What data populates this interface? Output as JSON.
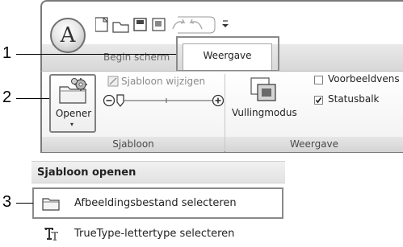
{
  "callouts": [
    "1",
    "2",
    "3"
  ],
  "app_button": {
    "letter": "A"
  },
  "tabs": {
    "inactive_label": "Begin scherm",
    "active_label": "Weergave"
  },
  "ribbon": {
    "opener_label": "Opener",
    "opener_arrow": "▾",
    "template_edit_label": "Sjabloon wijzigen",
    "fill_mode_label": "Vullingmodus",
    "preview_checkbox": {
      "label": "Voorbeeldvens",
      "checked": false
    },
    "statusbar_checkbox": {
      "label": "Statusbalk",
      "checked": true
    },
    "group1_label": "Sjabloon",
    "group2_label": "Weergave"
  },
  "menu": {
    "header": "Sjabloon openen",
    "items": [
      {
        "label": "Afbeeldingsbestand selecteren",
        "icon": "folder-icon"
      },
      {
        "label": "TrueType-lettertype selecteren",
        "icon": "truetype-font-icon"
      }
    ]
  },
  "colors": {
    "accent": "#8a8a8a",
    "checkmark": "#1a1a1a"
  }
}
